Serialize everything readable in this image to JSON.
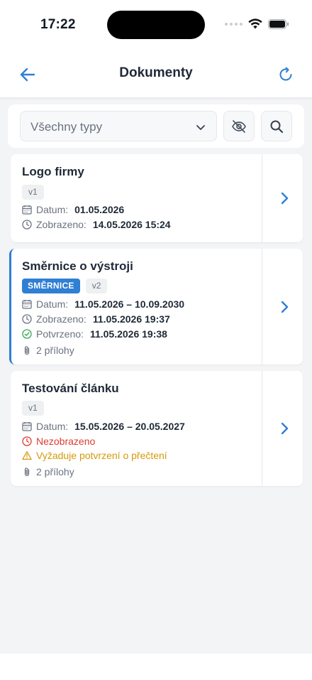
{
  "status_bar": {
    "time": "17:22"
  },
  "header": {
    "title": "Dokumenty"
  },
  "filters": {
    "type_select": "Všechny typy"
  },
  "documents": [
    {
      "title": "Logo firmy",
      "version": "v1",
      "date_label": "Datum:",
      "date_value": "01.05.2026",
      "viewed_label": "Zobrazeno:",
      "viewed_value": "14.05.2026 15:24"
    },
    {
      "title": "Směrnice o výstroji",
      "category": "SMĚRNICE",
      "version": "v2",
      "date_label": "Datum:",
      "date_value": "11.05.2026 – 10.09.2030",
      "viewed_label": "Zobrazeno:",
      "viewed_value": "11.05.2026 19:37",
      "confirmed_label": "Potvrzeno:",
      "confirmed_value": "11.05.2026 19:38",
      "attachments": "2 přílohy"
    },
    {
      "title": "Testování článku",
      "version": "v1",
      "date_label": "Datum:",
      "date_value": "15.05.2026 – 20.05.2027",
      "not_viewed": "Nezobrazeno",
      "requires_confirmation": "Vyžaduje potvrzení o přečtení",
      "attachments": "2 přílohy"
    }
  ],
  "colors": {
    "accent": "#2f7fd3",
    "warning": "#d49a0a",
    "danger": "#dc3b2f",
    "success": "#3aa655"
  }
}
